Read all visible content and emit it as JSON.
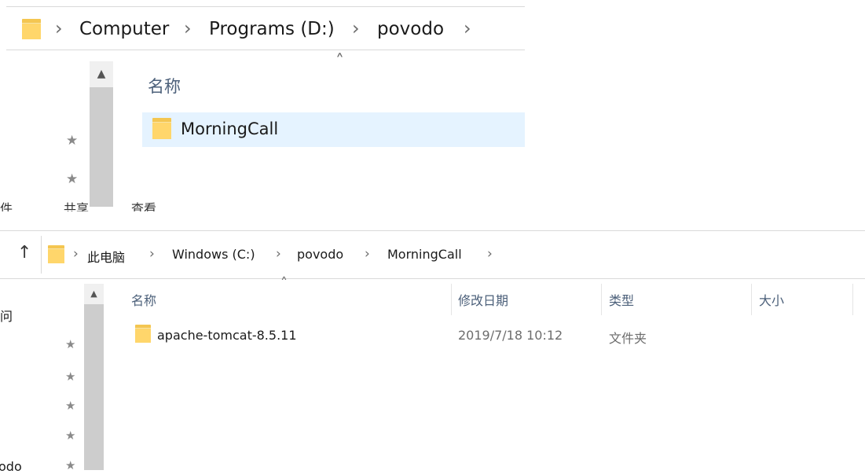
{
  "top": {
    "breadcrumb": [
      "Computer",
      "Programs (D:)",
      "povodo"
    ],
    "separator": "›",
    "column_name": "名称",
    "sort_arrow": "˄",
    "scroll_up": "▲",
    "items": [
      {
        "name": "MorningCall"
      }
    ]
  },
  "menu": {
    "items": [
      "查看"
    ],
    "cut_left": "件",
    "cut_mid": "共享"
  },
  "bottom": {
    "up_arrow": "↑",
    "breadcrumb": [
      "此电脑",
      "Windows (C:)",
      "povodo",
      "MorningCall"
    ],
    "separator": "›",
    "columns": {
      "name": "名称",
      "modified": "修改日期",
      "type": "类型",
      "size": "大小"
    },
    "sort_arrow": "˄",
    "scroll_up": "▲",
    "sidebar_cut": [
      "问",
      "odo"
    ],
    "rows": [
      {
        "name": "apache-tomcat-8.5.11",
        "modified": "2019/7/18 10:12",
        "type": "文件夹",
        "size": ""
      }
    ]
  },
  "colors": {
    "selection": "#e5f3ff",
    "folder": "#ffd66b",
    "folder_back": "#f4c651",
    "scrollbar": "#cdcdcd"
  },
  "icons": [
    "folder-icon",
    "pin-icon",
    "up-arrow-icon",
    "chevron-right-icon"
  ]
}
